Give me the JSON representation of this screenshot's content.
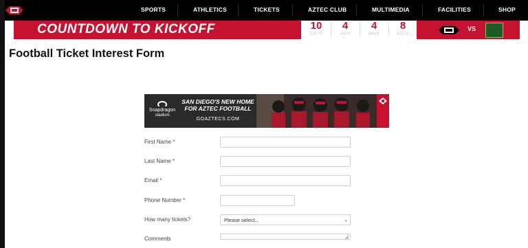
{
  "nav": {
    "logo_icon": "sdsu-logo-icon",
    "items": [
      "SPORTS",
      "ATHLETICS",
      "TICKETS",
      "AZTEC CLUB",
      "MULTIMEDIA",
      "FACILITIES",
      "SHOP"
    ]
  },
  "countdown": {
    "title": "COUNTDOWN TO KICKOFF",
    "units": [
      {
        "value": "10",
        "label": "DAYS"
      },
      {
        "value": "4",
        "label": "HRS"
      },
      {
        "value": "4",
        "label": "MINS"
      },
      {
        "value": "8",
        "label": "SECS"
      }
    ],
    "vs_label": "VS",
    "accent_color": "#c41230"
  },
  "page": {
    "title": "Football Ticket Interest Form"
  },
  "ad": {
    "brand_name": "Snapdragon",
    "brand_sub": "stadium",
    "headline_line1": "SAN DIEGO'S NEW HOME",
    "headline_line2": "FOR AZTEC FOOTBALL",
    "url": "GOAZTECS.COM"
  },
  "form": {
    "fields": [
      {
        "label": "First Name",
        "required": "*",
        "value": ""
      },
      {
        "label": "Last Name",
        "required": "*",
        "value": ""
      },
      {
        "label": "Email",
        "required": "*",
        "value": ""
      },
      {
        "label": "Phone Number",
        "required": "*",
        "value": ""
      },
      {
        "label": "How many tickets?",
        "required": "",
        "value": "Please select..."
      },
      {
        "label": "Comments",
        "required": "",
        "value": ""
      }
    ]
  }
}
